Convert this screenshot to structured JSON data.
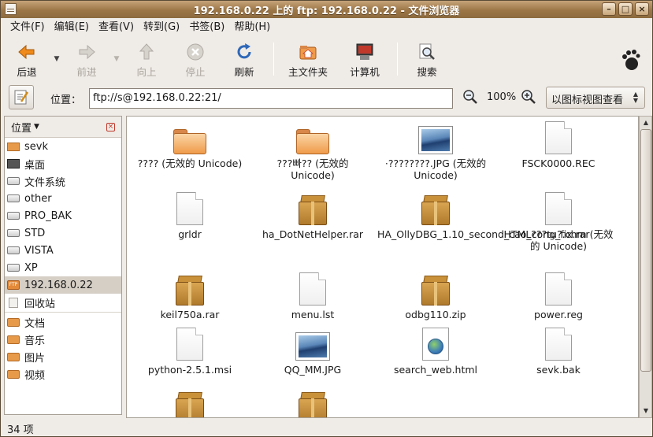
{
  "window": {
    "title": "192.168.0.22 上的 ftp: 192.168.0.22 - 文件浏览器"
  },
  "menu": [
    "文件(F)",
    "编辑(E)",
    "查看(V)",
    "转到(G)",
    "书签(B)",
    "帮助(H)"
  ],
  "toolbar": {
    "back": "后退",
    "forward": "前进",
    "up": "向上",
    "stop": "停止",
    "reload": "刷新",
    "home": "主文件夹",
    "computer": "计算机",
    "search": "搜索"
  },
  "location": {
    "label": "位置：",
    "value": "ftp://s@192.168.0.22:21/",
    "zoom": "100%",
    "view_mode": "以图标视图查看"
  },
  "sidebar": {
    "header": "位置",
    "items": [
      {
        "label": "sevk",
        "icon": "home-folder-icon"
      },
      {
        "label": "桌面",
        "icon": "desktop-icon"
      },
      {
        "label": "文件系统",
        "icon": "drive-icon"
      },
      {
        "label": "other",
        "icon": "drive-icon"
      },
      {
        "label": "PRO_BAK",
        "icon": "drive-icon"
      },
      {
        "label": "STD",
        "icon": "drive-icon"
      },
      {
        "label": "VISTA",
        "icon": "drive-icon"
      },
      {
        "label": "XP",
        "icon": "drive-icon"
      },
      {
        "label": "192.168.0.22",
        "icon": "ftp-icon"
      },
      {
        "label": "回收站",
        "icon": "trash-icon"
      },
      {
        "label": "文档",
        "icon": "folder-icon"
      },
      {
        "label": "音乐",
        "icon": "folder-icon"
      },
      {
        "label": "图片",
        "icon": "folder-icon"
      },
      {
        "label": "视频",
        "icon": "folder-icon"
      }
    ]
  },
  "files": [
    {
      "name": "???? (无效的 Unicode)",
      "type": "folder"
    },
    {
      "name": "???빠?? (无效的 Unicode)",
      "type": "folder"
    },
    {
      "name": "·????????.JPG (无效的 Unicode)",
      "type": "image"
    },
    {
      "name": "FSCK0000.REC",
      "type": "document"
    },
    {
      "name": "grldr",
      "type": "document"
    },
    {
      "name": "ha_DotNetHelper.rar",
      "type": "archive"
    },
    {
      "name": "HA_OllyDBG_1.10_second_cao_cong_fix.rar",
      "type": "archive"
    },
    {
      "name": "HTML???tu?.chm (无效的 Unicode)",
      "type": "document"
    },
    {
      "name": "keil750a.rar",
      "type": "archive"
    },
    {
      "name": "menu.lst",
      "type": "document"
    },
    {
      "name": "odbg110.zip",
      "type": "archive"
    },
    {
      "name": "power.reg",
      "type": "document"
    },
    {
      "name": "python-2.5.1.msi",
      "type": "document"
    },
    {
      "name": "QQ_MM.JPG",
      "type": "image"
    },
    {
      "name": "search_web.html",
      "type": "html"
    },
    {
      "name": "sevk.bak",
      "type": "document"
    },
    {
      "name": "",
      "type": "archive"
    },
    {
      "name": "",
      "type": "archive"
    }
  ],
  "status": "34 项"
}
